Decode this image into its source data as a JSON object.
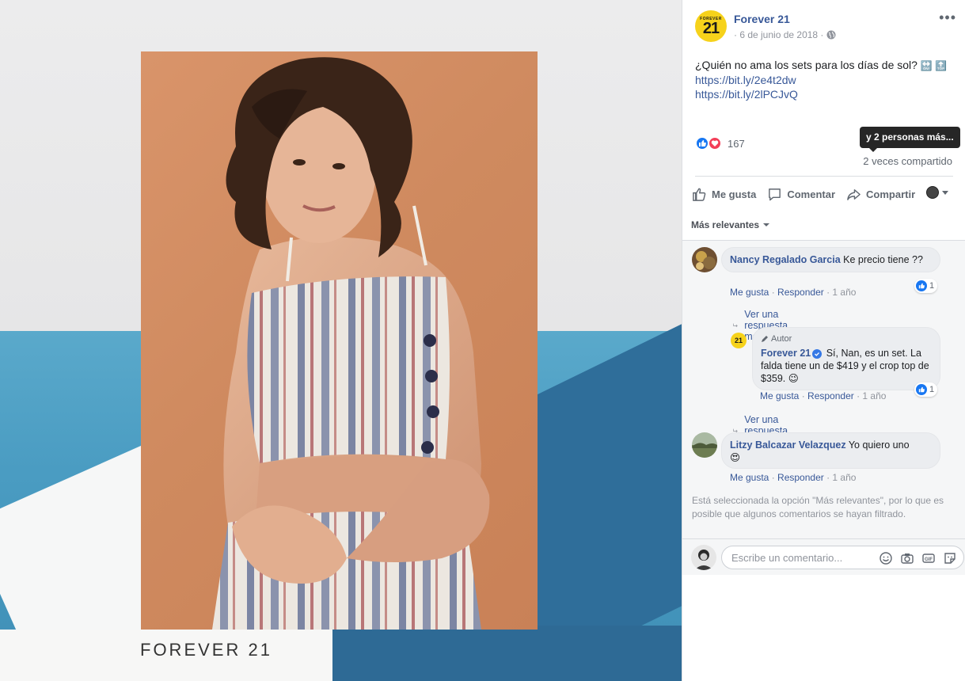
{
  "post": {
    "page_name": "Forever 21",
    "avatar_small": "FOREVER",
    "avatar_big": "21",
    "date": "· 6 de junio de 2018 ·",
    "text": "¿Quién no ama los sets para los días de sol?",
    "emoji_arrows": "🔛 🔝",
    "links": [
      "https://bit.ly/2e4t2dw",
      "https://bit.ly/2lPCJvQ"
    ],
    "reaction_count": "167",
    "tooltip": "y 2 personas más...",
    "shares": "2 veces compartido"
  },
  "actions": {
    "like": "Me gusta",
    "comment": "Comentar",
    "share": "Compartir"
  },
  "sort": {
    "label": "Más relevantes"
  },
  "comments": [
    {
      "author": "Nancy Regalado Garcia",
      "text": "Ke precio tiene ??",
      "like": "Me gusta",
      "reply": "Responder",
      "time": "1 año",
      "likes": "1",
      "view_more": "Ver una respuesta más"
    },
    {
      "tag": "Autor",
      "author": "Forever 21",
      "text": "Sí, Nan, es un set. La falda tiene un de $419 y el crop top de $359. 😉",
      "like": "Me gusta",
      "reply": "Responder",
      "time": "1 año",
      "likes": "1",
      "view_more": "Ver una respuesta más"
    },
    {
      "author": "Litzy Balcazar Velazquez",
      "text": "Yo quiero uno",
      "emoji": "😍",
      "like": "Me gusta",
      "reply": "Responder",
      "time": "1 año"
    }
  ],
  "filter_note": "Está seleccionada la opción \"Más relevantes\", por lo que es posible que algunos comentarios se hayan filtrado.",
  "composer": {
    "placeholder": "Escribe un comentario..."
  },
  "photo": {
    "brand_mark": "FOREVER 21"
  },
  "colors": {
    "link": "#385898",
    "like_blue": "#1877f2",
    "love_red": "#f33e58",
    "logo_yellow": "#f6d21b"
  },
  "icons": [
    "more-icon",
    "globe-icon",
    "like-icon",
    "comment-icon",
    "share-icon",
    "emoji-icon",
    "camera-icon",
    "gif-icon",
    "sticker-icon",
    "reply-arrow-icon",
    "pencil-icon",
    "verified-icon"
  ]
}
